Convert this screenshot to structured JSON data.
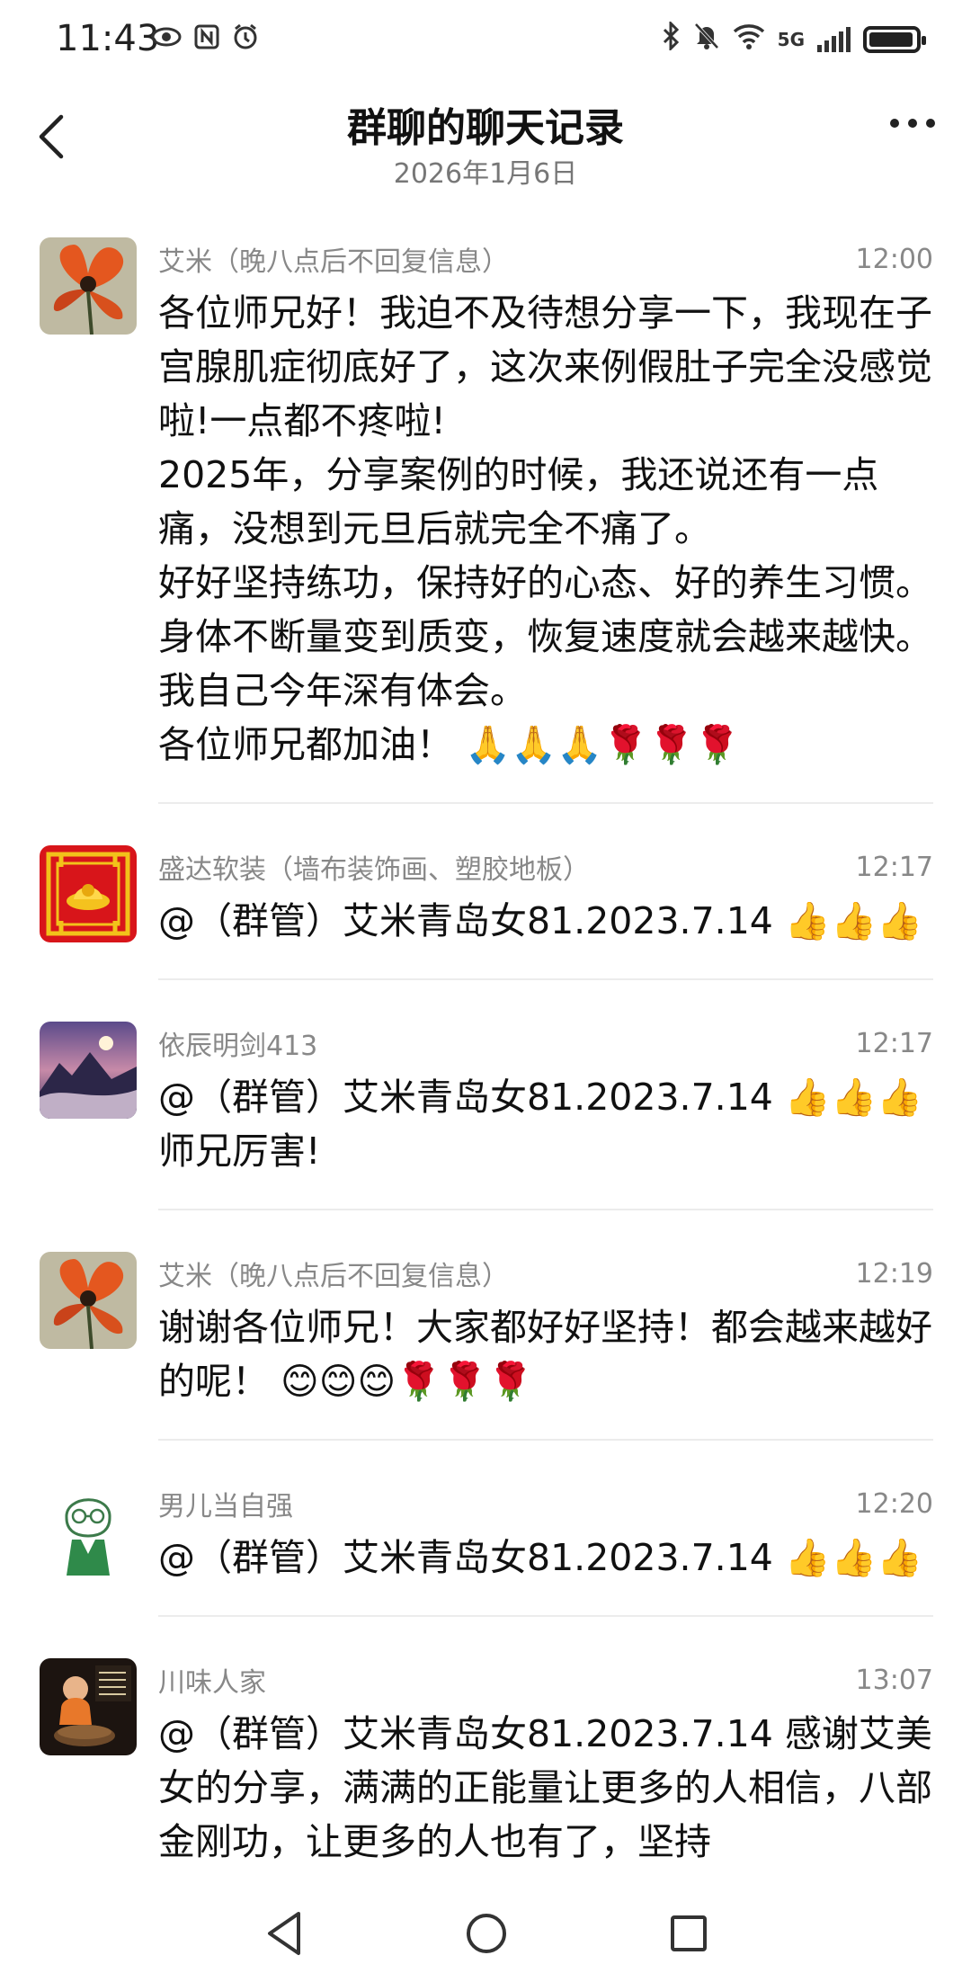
{
  "status_bar": {
    "time": "11:43",
    "network": "5G"
  },
  "header": {
    "title": "群聊的聊天记录",
    "date": "2026年1月6日"
  },
  "messages": [
    {
      "sender": "艾米（晚八点后不回复信息）",
      "time": "12:00",
      "text": "各位师兄好！我迫不及待想分享一下，我现在子宫腺肌症彻底好了，这次来例假肚子完全没感觉啦!一点都不疼啦!\n2025年，分享案例的时候，我还说还有一点痛，没想到元旦后就完全不痛了。\n好好坚持练功，保持好的心态、好的养生习惯。身体不断量变到质变，恢复速度就会越来越快。我自己今年深有体会。\n各位师兄都加油！ 🙏🙏🙏🌹🌹🌹"
    },
    {
      "sender": "盛达软装（墙布装饰画、塑胶地板）",
      "time": "12:17",
      "text": "@（群管）艾米青岛女81.2023.7.14 👍👍👍"
    },
    {
      "sender": "依辰明剑413",
      "time": "12:17",
      "text": "@（群管）艾米青岛女81.2023.7.14 👍👍👍师兄厉害!"
    },
    {
      "sender": "艾米（晚八点后不回复信息）",
      "time": "12:19",
      "text": "谢谢各位师兄！大家都好好坚持！都会越来越好的呢！ 😊😊😊🌹🌹🌹"
    },
    {
      "sender": "男儿当自强",
      "time": "12:20",
      "text": "@（群管）艾米青岛女81.2023.7.14 👍👍👍"
    },
    {
      "sender": "川味人家",
      "time": "13:07",
      "text": "@（群管）艾米青岛女81.2023.7.14 感谢艾美女的分享，满满的正能量让更多的人相信，八部金刚功，让更多的人也有了，坚持"
    }
  ]
}
